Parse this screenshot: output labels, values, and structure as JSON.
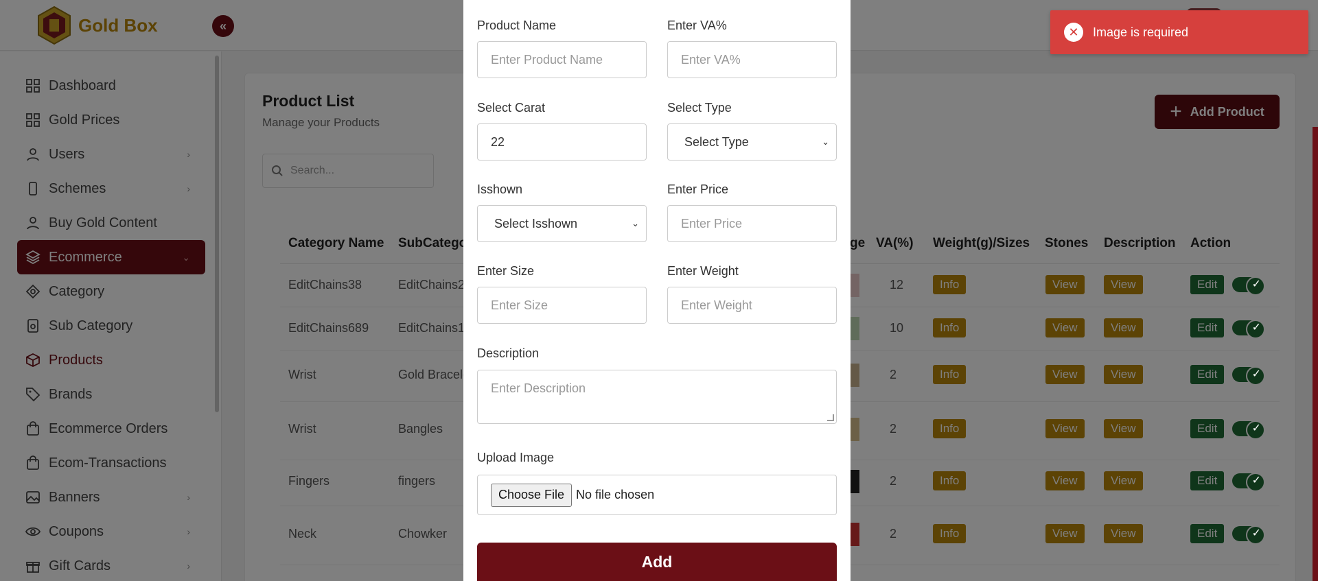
{
  "app": {
    "name": "Gold Box",
    "collapse_icon": "«"
  },
  "colors": {
    "brand": "#6b0f16",
    "gold": "#b8860b",
    "success": "#1f6b35",
    "toast_error": "#d6403d"
  },
  "sidebar": {
    "items": [
      {
        "label": "Dashboard",
        "icon": "grid-icon",
        "chevron": false,
        "state": ""
      },
      {
        "label": "Gold Prices",
        "icon": "grid-icon",
        "chevron": false,
        "state": ""
      },
      {
        "label": "Users",
        "icon": "user-icon",
        "chevron": true,
        "state": ""
      },
      {
        "label": "Schemes",
        "icon": "phone-icon",
        "chevron": true,
        "state": ""
      },
      {
        "label": "Buy Gold Content",
        "icon": "user-icon",
        "chevron": false,
        "state": ""
      },
      {
        "label": "Ecommerce",
        "icon": "layers-icon",
        "chevron": true,
        "state": "active"
      },
      {
        "label": "Category",
        "icon": "cube-icon",
        "chevron": false,
        "state": ""
      },
      {
        "label": "Sub Category",
        "icon": "safe-icon",
        "chevron": false,
        "state": ""
      },
      {
        "label": "Products",
        "icon": "box-icon",
        "chevron": false,
        "state": "current"
      },
      {
        "label": "Brands",
        "icon": "tag-icon",
        "chevron": false,
        "state": ""
      },
      {
        "label": "Ecommerce Orders",
        "icon": "bag-icon",
        "chevron": false,
        "state": ""
      },
      {
        "label": "Ecom-Transactions",
        "icon": "bag-icon",
        "chevron": false,
        "state": ""
      },
      {
        "label": "Banners",
        "icon": "image-icon",
        "chevron": true,
        "state": ""
      },
      {
        "label": "Coupons",
        "icon": "eye-icon",
        "chevron": true,
        "state": ""
      },
      {
        "label": "Gift Cards",
        "icon": "gift-icon",
        "chevron": true,
        "state": ""
      }
    ],
    "chevron_glyph": "›",
    "expanded_glyph": "⌄"
  },
  "main": {
    "title": "Product List",
    "subtitle": "Manage your Products",
    "search_placeholder": "Search...",
    "add_button": "Add Product",
    "table": {
      "headers": {
        "category": "Category Name",
        "subcategory": "SubCatego",
        "image_partial": "ge",
        "va": "VA(%)",
        "weight": "Weight(g)/Sizes",
        "stones": "Stones",
        "description": "Description",
        "action": "Action"
      },
      "rows": [
        {
          "category": "EditChains38",
          "subcategory": "EditChains2",
          "va": "12",
          "info": "Info",
          "stones": "View",
          "description": "View",
          "edit": "Edit",
          "enabled": true
        },
        {
          "category": "EditChains689",
          "subcategory": "EditChains1",
          "va": "10",
          "info": "Info",
          "stones": "View",
          "description": "View",
          "edit": "Edit",
          "enabled": true
        },
        {
          "category": "Wrist",
          "subcategory": "Gold Bracele",
          "va": "2",
          "info": "Info",
          "stones": "View",
          "description": "View",
          "edit": "Edit",
          "enabled": true
        },
        {
          "category": "Wrist",
          "subcategory": "Bangles",
          "va": "2",
          "info": "Info",
          "stones": "View",
          "description": "View",
          "edit": "Edit",
          "enabled": true
        },
        {
          "category": "Fingers",
          "subcategory": "fingers",
          "va": "2",
          "info": "Info",
          "stones": "View",
          "description": "View",
          "edit": "Edit",
          "enabled": true
        },
        {
          "category": "Neck",
          "subcategory": "Chowker",
          "va": "2",
          "info": "Info",
          "stones": "View",
          "description": "View",
          "edit": "Edit",
          "enabled": true
        }
      ]
    }
  },
  "modal": {
    "product_name": {
      "label": "Product Name",
      "placeholder": "Enter Product Name",
      "value": ""
    },
    "va": {
      "label": "Enter VA%",
      "placeholder": "Enter VA%",
      "value": ""
    },
    "carat": {
      "label": "Select Carat",
      "value": "22"
    },
    "type": {
      "label": "Select Type",
      "selected": "Select Type"
    },
    "isshown": {
      "label": "Isshown",
      "selected": "Select Isshown"
    },
    "price": {
      "label": "Enter Price",
      "placeholder": "Enter Price",
      "value": ""
    },
    "size": {
      "label": "Enter Size",
      "placeholder": "Enter Size",
      "value": ""
    },
    "weight": {
      "label": "Enter Weight",
      "placeholder": "Enter Weight",
      "value": ""
    },
    "description": {
      "label": "Description",
      "placeholder": "Enter Description"
    },
    "upload": {
      "label": "Upload Image",
      "button": "Choose File",
      "status": "No file chosen"
    },
    "submit": "Add",
    "select_caret": "⌄"
  },
  "toast": {
    "message": "Image is required",
    "icon": "error-icon",
    "icon_glyph": "✕"
  }
}
